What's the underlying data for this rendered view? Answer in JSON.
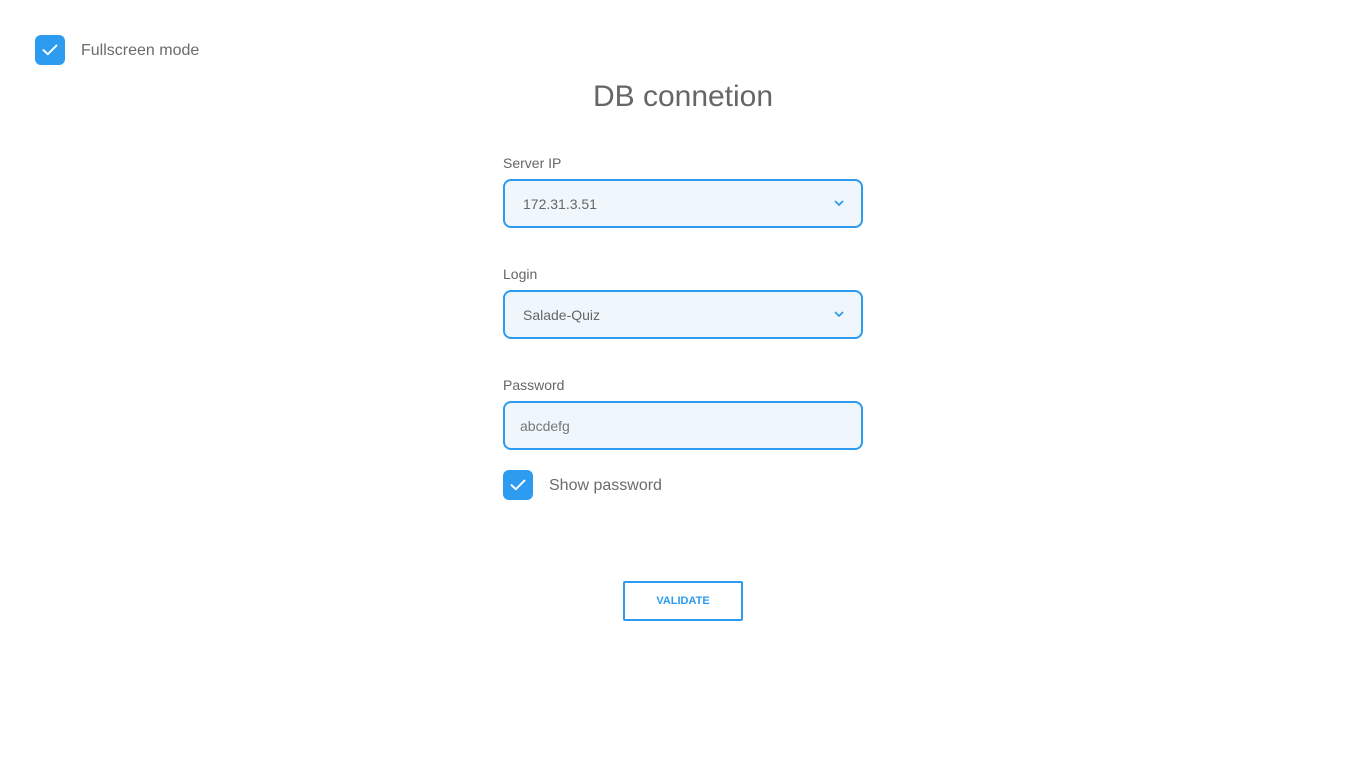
{
  "fullscreen": {
    "label": "Fullscreen mode",
    "checked": true
  },
  "title": "DB connetion",
  "server_ip": {
    "label": "Server IP",
    "value": "172.31.3.51",
    "icon": "chevron-down-icon"
  },
  "login": {
    "label": "Login",
    "value": "Salade-Quiz",
    "icon": "chevron-down-icon"
  },
  "password": {
    "label": "Password",
    "value": "abcdefg"
  },
  "show_password": {
    "label": "Show password",
    "checked": true
  },
  "validate": {
    "label": "VALIDATE"
  },
  "colors": {
    "accent": "#2d9bf0",
    "field_background": "#eff7fd",
    "text": "#666666"
  }
}
